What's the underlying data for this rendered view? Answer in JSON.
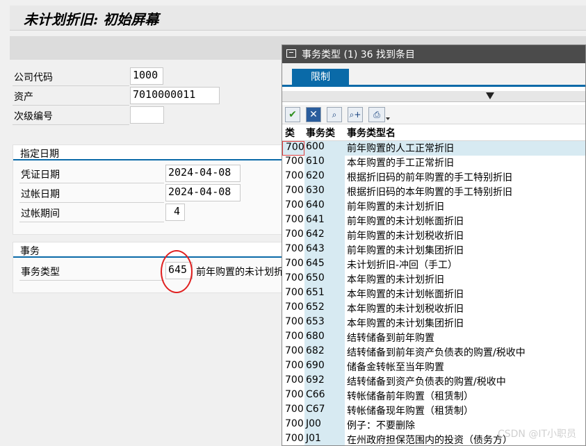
{
  "screen": {
    "title": "未计划折旧: 初始屏幕"
  },
  "fields": {
    "company_code_label": "公司代码",
    "company_code_value": "1000",
    "asset_label": "资产",
    "asset_value": "7010000011",
    "subnumber_label": "次级编号",
    "subnumber_value": ""
  },
  "dates_group": {
    "title": "指定日期",
    "doc_date_label": "凭证日期",
    "doc_date_value": "2024-04-08",
    "posting_date_label": "过帐日期",
    "posting_date_value": "2024-04-08",
    "period_label": "过帐期间",
    "period_value": "4"
  },
  "transaction_group": {
    "title": "事务",
    "type_label": "事务类型",
    "type_value": "645",
    "type_desc": "前年购置的未计划折"
  },
  "popup": {
    "title": "事务类型 (1)   36 找到条目",
    "tab_label": "限制",
    "col_class": "类",
    "col_type": "事务类",
    "col_name": "事务类型名",
    "rows": [
      {
        "cls": "700",
        "type": "600",
        "name": "前年购置的人工正常折旧"
      },
      {
        "cls": "700",
        "type": "610",
        "name": "本年购置的手工正常折旧"
      },
      {
        "cls": "700",
        "type": "620",
        "name": "根据折旧码的前年购置的手工特别折旧"
      },
      {
        "cls": "700",
        "type": "630",
        "name": "根据折旧码的本年购置的手工特别折旧"
      },
      {
        "cls": "700",
        "type": "640",
        "name": "前年购置的未计划折旧"
      },
      {
        "cls": "700",
        "type": "641",
        "name": "前年购置的未计划帐面折旧"
      },
      {
        "cls": "700",
        "type": "642",
        "name": "前年购置的未计划税收折旧"
      },
      {
        "cls": "700",
        "type": "643",
        "name": "前年购置的未计划集团折旧"
      },
      {
        "cls": "700",
        "type": "645",
        "name": "未计划折旧-冲回（手工）"
      },
      {
        "cls": "700",
        "type": "650",
        "name": "本年购置的未计划折旧"
      },
      {
        "cls": "700",
        "type": "651",
        "name": "本年购置的未计划帐面折旧"
      },
      {
        "cls": "700",
        "type": "652",
        "name": "本年购置的未计划税收折旧"
      },
      {
        "cls": "700",
        "type": "653",
        "name": "本年购置的未计划集团折旧"
      },
      {
        "cls": "700",
        "type": "680",
        "name": "结转储备到前年购置"
      },
      {
        "cls": "700",
        "type": "682",
        "name": "结转储备到前年资产负债表的购置/税收中"
      },
      {
        "cls": "700",
        "type": "690",
        "name": "储备金转帐至当年购置"
      },
      {
        "cls": "700",
        "type": "692",
        "name": "结转储备到资产负债表的购置/税收中"
      },
      {
        "cls": "700",
        "type": "C66",
        "name": "转帐储备前年购置（租赁制）"
      },
      {
        "cls": "700",
        "type": "C67",
        "name": "转帐储备现年购置（租赁制）"
      },
      {
        "cls": "700",
        "type": "J00",
        "name": "例子：不要删除"
      },
      {
        "cls": "700",
        "type": "J01",
        "name": "在州政府担保范围内的投资（债务方）"
      }
    ]
  },
  "watermark": "CSDN @IT小职员"
}
